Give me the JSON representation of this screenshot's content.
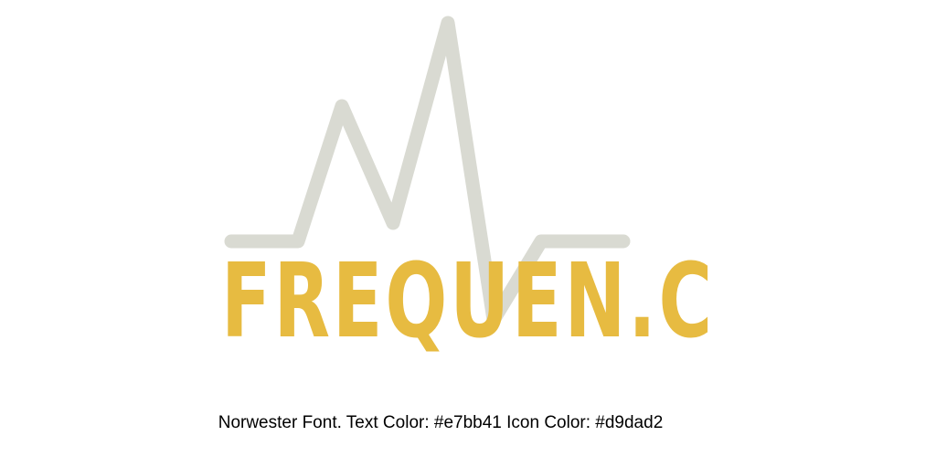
{
  "logo": {
    "wordmark": "FREQUEN.C",
    "wordmark_color": "#e7bb41",
    "icon_name": "heartbeat-pulse-icon",
    "icon_color": "#d9dad2"
  },
  "caption": {
    "text": "Norwester Font. Text Color: #e7bb41 Icon Color: #d9dad2"
  }
}
